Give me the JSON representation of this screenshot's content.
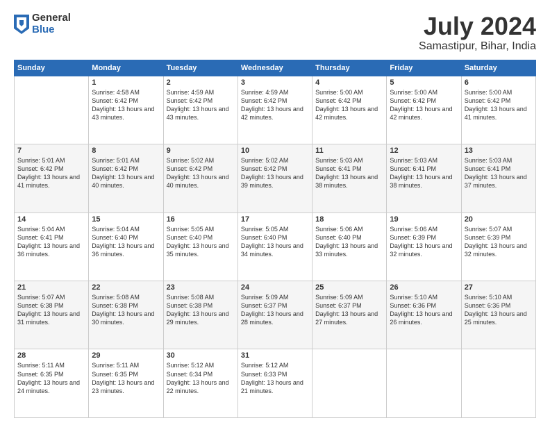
{
  "logo": {
    "general": "General",
    "blue": "Blue"
  },
  "title": "July 2024",
  "subtitle": "Samastipur, Bihar, India",
  "days": [
    "Sunday",
    "Monday",
    "Tuesday",
    "Wednesday",
    "Thursday",
    "Friday",
    "Saturday"
  ],
  "weeks": [
    [
      {
        "day": "",
        "sunrise": "",
        "sunset": "",
        "daylight": ""
      },
      {
        "day": "1",
        "sunrise": "Sunrise: 4:58 AM",
        "sunset": "Sunset: 6:42 PM",
        "daylight": "Daylight: 13 hours and 43 minutes."
      },
      {
        "day": "2",
        "sunrise": "Sunrise: 4:59 AM",
        "sunset": "Sunset: 6:42 PM",
        "daylight": "Daylight: 13 hours and 43 minutes."
      },
      {
        "day": "3",
        "sunrise": "Sunrise: 4:59 AM",
        "sunset": "Sunset: 6:42 PM",
        "daylight": "Daylight: 13 hours and 42 minutes."
      },
      {
        "day": "4",
        "sunrise": "Sunrise: 5:00 AM",
        "sunset": "Sunset: 6:42 PM",
        "daylight": "Daylight: 13 hours and 42 minutes."
      },
      {
        "day": "5",
        "sunrise": "Sunrise: 5:00 AM",
        "sunset": "Sunset: 6:42 PM",
        "daylight": "Daylight: 13 hours and 42 minutes."
      },
      {
        "day": "6",
        "sunrise": "Sunrise: 5:00 AM",
        "sunset": "Sunset: 6:42 PM",
        "daylight": "Daylight: 13 hours and 41 minutes."
      }
    ],
    [
      {
        "day": "7",
        "sunrise": "Sunrise: 5:01 AM",
        "sunset": "Sunset: 6:42 PM",
        "daylight": "Daylight: 13 hours and 41 minutes."
      },
      {
        "day": "8",
        "sunrise": "Sunrise: 5:01 AM",
        "sunset": "Sunset: 6:42 PM",
        "daylight": "Daylight: 13 hours and 40 minutes."
      },
      {
        "day": "9",
        "sunrise": "Sunrise: 5:02 AM",
        "sunset": "Sunset: 6:42 PM",
        "daylight": "Daylight: 13 hours and 40 minutes."
      },
      {
        "day": "10",
        "sunrise": "Sunrise: 5:02 AM",
        "sunset": "Sunset: 6:42 PM",
        "daylight": "Daylight: 13 hours and 39 minutes."
      },
      {
        "day": "11",
        "sunrise": "Sunrise: 5:03 AM",
        "sunset": "Sunset: 6:41 PM",
        "daylight": "Daylight: 13 hours and 38 minutes."
      },
      {
        "day": "12",
        "sunrise": "Sunrise: 5:03 AM",
        "sunset": "Sunset: 6:41 PM",
        "daylight": "Daylight: 13 hours and 38 minutes."
      },
      {
        "day": "13",
        "sunrise": "Sunrise: 5:03 AM",
        "sunset": "Sunset: 6:41 PM",
        "daylight": "Daylight: 13 hours and 37 minutes."
      }
    ],
    [
      {
        "day": "14",
        "sunrise": "Sunrise: 5:04 AM",
        "sunset": "Sunset: 6:41 PM",
        "daylight": "Daylight: 13 hours and 36 minutes."
      },
      {
        "day": "15",
        "sunrise": "Sunrise: 5:04 AM",
        "sunset": "Sunset: 6:40 PM",
        "daylight": "Daylight: 13 hours and 36 minutes."
      },
      {
        "day": "16",
        "sunrise": "Sunrise: 5:05 AM",
        "sunset": "Sunset: 6:40 PM",
        "daylight": "Daylight: 13 hours and 35 minutes."
      },
      {
        "day": "17",
        "sunrise": "Sunrise: 5:05 AM",
        "sunset": "Sunset: 6:40 PM",
        "daylight": "Daylight: 13 hours and 34 minutes."
      },
      {
        "day": "18",
        "sunrise": "Sunrise: 5:06 AM",
        "sunset": "Sunset: 6:40 PM",
        "daylight": "Daylight: 13 hours and 33 minutes."
      },
      {
        "day": "19",
        "sunrise": "Sunrise: 5:06 AM",
        "sunset": "Sunset: 6:39 PM",
        "daylight": "Daylight: 13 hours and 32 minutes."
      },
      {
        "day": "20",
        "sunrise": "Sunrise: 5:07 AM",
        "sunset": "Sunset: 6:39 PM",
        "daylight": "Daylight: 13 hours and 32 minutes."
      }
    ],
    [
      {
        "day": "21",
        "sunrise": "Sunrise: 5:07 AM",
        "sunset": "Sunset: 6:38 PM",
        "daylight": "Daylight: 13 hours and 31 minutes."
      },
      {
        "day": "22",
        "sunrise": "Sunrise: 5:08 AM",
        "sunset": "Sunset: 6:38 PM",
        "daylight": "Daylight: 13 hours and 30 minutes."
      },
      {
        "day": "23",
        "sunrise": "Sunrise: 5:08 AM",
        "sunset": "Sunset: 6:38 PM",
        "daylight": "Daylight: 13 hours and 29 minutes."
      },
      {
        "day": "24",
        "sunrise": "Sunrise: 5:09 AM",
        "sunset": "Sunset: 6:37 PM",
        "daylight": "Daylight: 13 hours and 28 minutes."
      },
      {
        "day": "25",
        "sunrise": "Sunrise: 5:09 AM",
        "sunset": "Sunset: 6:37 PM",
        "daylight": "Daylight: 13 hours and 27 minutes."
      },
      {
        "day": "26",
        "sunrise": "Sunrise: 5:10 AM",
        "sunset": "Sunset: 6:36 PM",
        "daylight": "Daylight: 13 hours and 26 minutes."
      },
      {
        "day": "27",
        "sunrise": "Sunrise: 5:10 AM",
        "sunset": "Sunset: 6:36 PM",
        "daylight": "Daylight: 13 hours and 25 minutes."
      }
    ],
    [
      {
        "day": "28",
        "sunrise": "Sunrise: 5:11 AM",
        "sunset": "Sunset: 6:35 PM",
        "daylight": "Daylight: 13 hours and 24 minutes."
      },
      {
        "day": "29",
        "sunrise": "Sunrise: 5:11 AM",
        "sunset": "Sunset: 6:35 PM",
        "daylight": "Daylight: 13 hours and 23 minutes."
      },
      {
        "day": "30",
        "sunrise": "Sunrise: 5:12 AM",
        "sunset": "Sunset: 6:34 PM",
        "daylight": "Daylight: 13 hours and 22 minutes."
      },
      {
        "day": "31",
        "sunrise": "Sunrise: 5:12 AM",
        "sunset": "Sunset: 6:33 PM",
        "daylight": "Daylight: 13 hours and 21 minutes."
      },
      {
        "day": "",
        "sunrise": "",
        "sunset": "",
        "daylight": ""
      },
      {
        "day": "",
        "sunrise": "",
        "sunset": "",
        "daylight": ""
      },
      {
        "day": "",
        "sunrise": "",
        "sunset": "",
        "daylight": ""
      }
    ]
  ]
}
